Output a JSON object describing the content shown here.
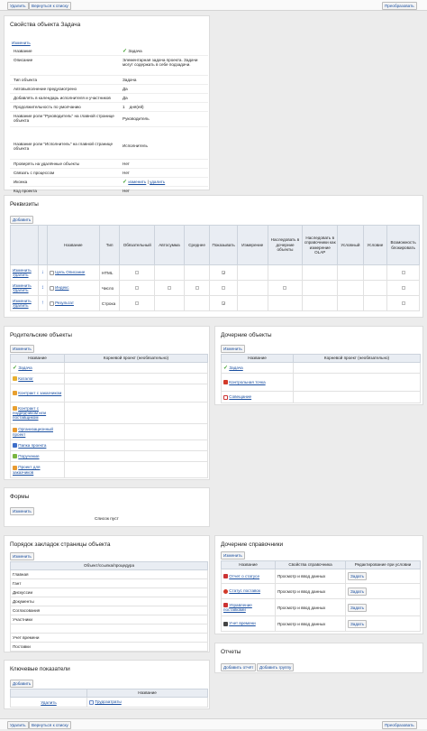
{
  "toolbar": {
    "delete_label": "Удалить",
    "back_label": "Вернуться к списку",
    "transform_label": "Преобразовать"
  },
  "properties": {
    "title": "Свойства объекта Задача",
    "edit_label": "Изменить",
    "rows": [
      {
        "key": "Название",
        "value": "Задача"
      },
      {
        "key": "Описание",
        "value": "Элементарная задача проекта. Задачи могут содержать в себе подзадачи."
      },
      {
        "key": "Тип объекта",
        "value": "Задача"
      },
      {
        "key": "Автовыполнение предусмотрено",
        "value": "Да"
      },
      {
        "key": "Добавлять в календарь исполнителя и участников",
        "value": "Да"
      },
      {
        "key": "Продолжительность по умолчанию",
        "value": "1",
        "unit": "дня(ей)"
      },
      {
        "key": "Название роли \"Руководитель\" на главной странице объекта",
        "value": "Руководитель"
      },
      {
        "key": "Название роли \"Исполнитель\" на главной странице объекта",
        "value": "Исполнитель"
      },
      {
        "key": "Проверять на удалённые объекты",
        "value": "Нет"
      },
      {
        "key": "Связать с процессом",
        "value": "Нет"
      },
      {
        "key": "Иконка",
        "value": "",
        "icon_edit": "изменить",
        "icon_delete": "удалить"
      },
      {
        "key": "Код проекта",
        "value": "Нет"
      }
    ]
  },
  "requisites": {
    "title": "Реквизиты",
    "add_label": "Добавить",
    "columns": [
      "Название",
      "Тип",
      "Обязательный",
      "Автосумма",
      "Среднее",
      "Показывать",
      "Измерение",
      "Наследовать в дочерние объекты",
      "Наследовать в справочники как измерение OLAP",
      "Условный",
      "Условие",
      "Возможность блокировать"
    ],
    "row_edit": "Изменить",
    "row_delete": "Удалить",
    "rows": [
      {
        "name": "Цель Описание",
        "type": "HTML",
        "show": true
      },
      {
        "name": "Индекс",
        "type": "Число",
        "show": false
      },
      {
        "name": "Результат",
        "type": "Строка",
        "show": true
      }
    ]
  },
  "parents": {
    "title": "Родительские объекты",
    "edit_label": "Изменить",
    "col_name": "Название",
    "col_root": "Корневой проект (необязательно)",
    "items": [
      {
        "name": "Задача",
        "icon": "check-icon"
      },
      {
        "name": "Каталог",
        "icon": "folder-icon"
      },
      {
        "name": "Контракт с заказчиком",
        "icon": "contract-icon"
      },
      {
        "name": "Контракт с подрядчиком или поставщиком",
        "icon": "contract-icon"
      },
      {
        "name": "Организационный проект",
        "icon": "project-icon"
      },
      {
        "name": "Папка проекта",
        "icon": "folder-blue-icon"
      },
      {
        "name": "Поручение",
        "icon": "check-icon"
      },
      {
        "name": "Проект для заказчиков",
        "icon": "project-icon"
      }
    ]
  },
  "children": {
    "title": "Дочерние объекты",
    "edit_label": "Изменить",
    "col_name": "Название",
    "col_root": "Корневой проект (необязательно)",
    "items": [
      {
        "name": "Задача",
        "icon": "check-icon"
      },
      {
        "name": "Контрольная точка",
        "icon": "flag-icon"
      },
      {
        "name": "Совещание",
        "icon": "calendar-icon"
      }
    ]
  },
  "forms": {
    "title": "Формы",
    "edit_label": "Изменить",
    "empty_text": "Список пуст"
  },
  "tabs_order": {
    "title": "Порядок закладок страницы объекта",
    "edit_label": "Изменить",
    "col": "Объект/ссылка/процедура",
    "items": [
      "Главная",
      "Гант",
      "Дискуссии",
      "Документы",
      "Согласования",
      "Участники",
      "",
      "Учет времени",
      "Поставки"
    ]
  },
  "child_dicts": {
    "title": "Дочерние справочники",
    "edit_label": "Изменить",
    "columns": [
      "Название",
      "Свойства справочника",
      "Редактирование при условии"
    ],
    "action_label": "Задать",
    "rows": [
      {
        "name": "Отчет о статусе",
        "props": "Просмотр и ввод данных"
      },
      {
        "name": "Статус поставок",
        "props": "Просмотр и ввод данных"
      },
      {
        "name": "Управление поставками",
        "props": "Просмотр и ввод данных"
      },
      {
        "name": "Учет времени",
        "props": "Просмотр и ввод данных"
      }
    ]
  },
  "reports": {
    "title": "Отчеты",
    "add_report": "Добавить отчёт",
    "add_group": "Добавить группу"
  },
  "kpi": {
    "title": "Ключевые показатели",
    "add_label": "Добавить",
    "col_name": "Название",
    "row_delete": "Удалить",
    "rows": [
      {
        "name": "Трудозатраты"
      }
    ]
  }
}
